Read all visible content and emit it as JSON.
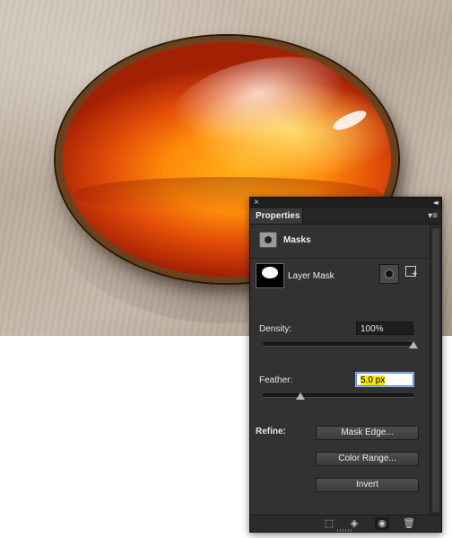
{
  "panel": {
    "close_glyph": "×",
    "collapse_glyph": "◂◂",
    "tab_label": "Properties",
    "menu_glyph": "▾≡",
    "masks_label": "Masks",
    "layer_mask_label": "Layer Mask",
    "density": {
      "label": "Density:",
      "value": "100%",
      "level_percent": 100
    },
    "feather": {
      "label": "Feather:",
      "value": "5.0 px",
      "level_fraction": 0.25
    },
    "refine": {
      "label": "Refine:",
      "buttons": [
        "Mask Edge...",
        "Color Range...",
        "Invert"
      ]
    },
    "footer_icons": [
      "load-selection-icon",
      "apply-mask-icon",
      "eye-icon",
      "trash-icon"
    ]
  },
  "colors": {
    "panel_bg": "#323232",
    "selection_highlight": "#f5e400",
    "gem_orange": "#ff8a0a"
  }
}
